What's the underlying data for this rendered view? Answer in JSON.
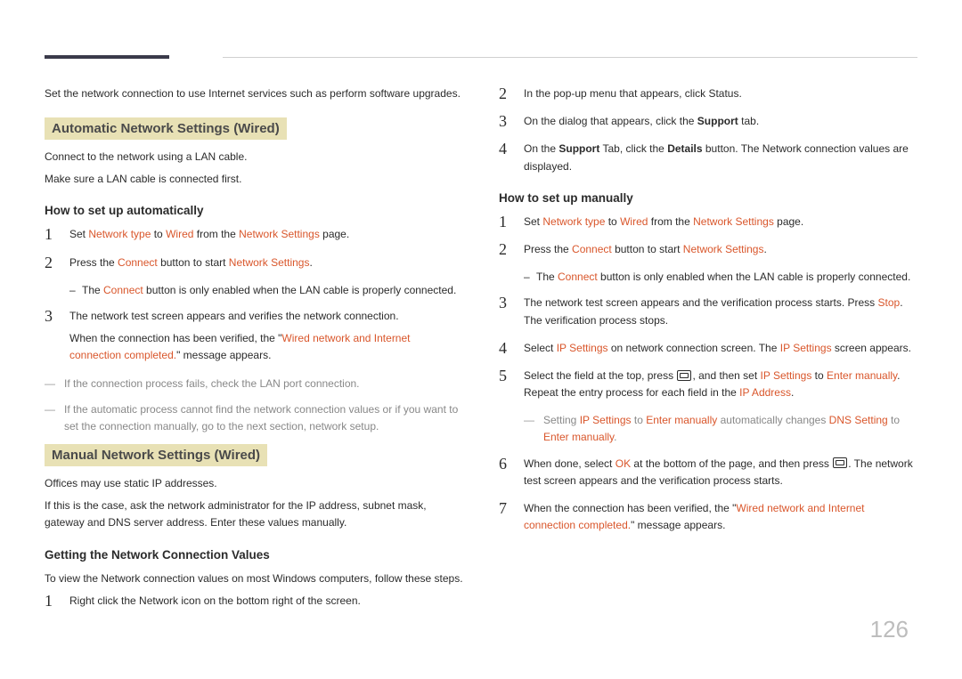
{
  "page_number": "126",
  "left": {
    "intro": "Set the network connection to use Internet services such as perform software upgrades.",
    "heading1": "Automatic Network Settings (Wired)",
    "p1a": "Connect to the network using a LAN cable.",
    "p1b": "Make sure a LAN cable is connected first.",
    "sub1": "How to set up automatically",
    "s1_pre": "Set ",
    "s1_nt": "Network type",
    "s1_mid1": " to ",
    "s1_wired": "Wired",
    "s1_mid2": " from the ",
    "s1_ns": "Network Settings",
    "s1_post": " page.",
    "s2_pre": "Press the ",
    "s2_connect": "Connect",
    "s2_mid": " button to start ",
    "s2_ns": "Network Settings",
    "s2_post": ".",
    "s2_note_pre": "The ",
    "s2_note_connect": "Connect",
    "s2_note_post": " button is only enabled when the LAN cable is properly connected.",
    "s3_a": "The network test screen appears and verifies the network connection.",
    "s3_b_pre": "When the connection has been verified, the \"",
    "s3_b_hl": "Wired network and Internet connection completed.",
    "s3_b_post": "\" message appears.",
    "tip1": "If the connection process fails, check the LAN port connection.",
    "tip2": "If the automatic process cannot find the network connection values or if you want to set the connection manually, go to the next section, network setup.",
    "heading2": "Manual Network Settings (Wired)",
    "p2a": "Offices may use static IP addresses.",
    "p2b": "If this is the case, ask the network administrator for the IP address, subnet mask, gateway and DNS server address. Enter these values manually.",
    "sub2": "Getting the Network Connection Values",
    "p2c": "To view the Network connection values on most Windows computers, follow these steps.",
    "g1": "Right click the Network icon on the bottom right of the screen."
  },
  "right": {
    "g2": "In the pop-up menu that appears, click Status.",
    "g3_pre": "On the dialog that appears, click the ",
    "g3_b": "Support",
    "g3_post": " tab.",
    "g4_pre": "On the ",
    "g4_b1": "Support",
    "g4_mid1": " Tab, click the ",
    "g4_b2": "Details",
    "g4_post": " button. The Network connection values are displayed.",
    "sub3": "How to set up manually",
    "m1_pre": "Set ",
    "m1_nt": "Network type",
    "m1_mid1": " to ",
    "m1_wired": "Wired",
    "m1_mid2": " from the ",
    "m1_ns": "Network Settings",
    "m1_post": " page.",
    "m2_pre": "Press the ",
    "m2_connect": "Connect",
    "m2_mid": " button to start ",
    "m2_ns": "Network Settings",
    "m2_post": ".",
    "m2_note_pre": "The ",
    "m2_note_connect": "Connect",
    "m2_note_post": " button is only enabled when the LAN cable is properly connected.",
    "m3_pre": "The network test screen appears and the verification process starts. Press ",
    "m3_stop": "Stop",
    "m3_post": ". The verification process stops.",
    "m4_pre": "Select ",
    "m4_ip1": "IP Settings",
    "m4_mid": " on network connection screen. The ",
    "m4_ip2": "IP Settings",
    "m4_post": " screen appears.",
    "m5_pre": "Select the field at the top, press ",
    "m5_mid1": ", and then set ",
    "m5_ip": "IP Settings",
    "m5_mid2": " to ",
    "m5_em": "Enter manually",
    "m5_mid3": ". Repeat the entry process for each field in the ",
    "m5_ipaddr": "IP Address",
    "m5_post": ".",
    "m5_tip_pre": "Setting ",
    "m5_tip_ip": "IP Settings",
    "m5_tip_mid1": " to ",
    "m5_tip_em1": "Enter manually",
    "m5_tip_mid2": " automatically changes ",
    "m5_tip_dns": "DNS Setting",
    "m5_tip_mid3": " to ",
    "m5_tip_em2": "Enter manually",
    "m5_tip_post": ".",
    "m6_pre": "When done, select ",
    "m6_ok": "OK",
    "m6_mid": " at the bottom of the page, and then press ",
    "m6_post": ". The network test screen appears and the verification process starts.",
    "m7_pre": "When the connection has been verified, the \"",
    "m7_hl": "Wired network and Internet connection completed.",
    "m7_post": "\" message appears."
  }
}
